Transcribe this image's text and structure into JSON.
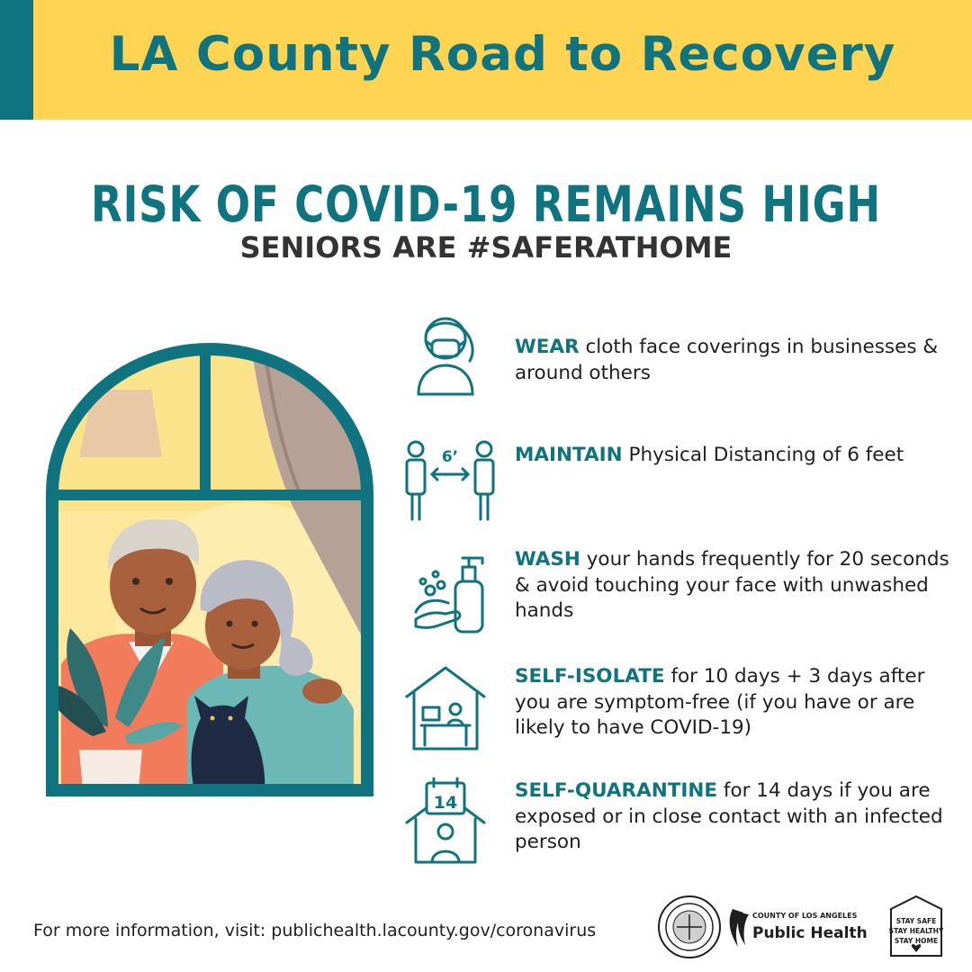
{
  "banner": {
    "title": "LA County Road to Recovery"
  },
  "headline": {
    "title": "RISK OF COVID-19 REMAINS HIGH",
    "subtitle": "SENIORS ARE #SAFERATHOME"
  },
  "tips": [
    {
      "keyword": "WEAR",
      "text": " cloth face coverings in businesses & around others",
      "icon": "face-mask-icon"
    },
    {
      "keyword": "MAINTAIN",
      "text": " Physical Distancing of 6 feet",
      "icon": "physical-distance-icon",
      "icon_label": "6’"
    },
    {
      "keyword": "WASH",
      "text": " your hands frequently for 20 seconds & avoid touching your face with unwashed hands",
      "icon": "hand-wash-icon"
    },
    {
      "keyword": "SELF-ISOLATE",
      "text": " for 10 days + 3 days after you are symptom-free (if you have or are likely to have COVID-19)",
      "icon": "house-isolate-icon"
    },
    {
      "keyword": "SELF-QUARANTINE",
      "text": " for 14 days if you are exposed or in close contact with an infected person",
      "icon": "calendar-quarantine-icon",
      "icon_label": "14"
    }
  ],
  "footer": {
    "text": "For more information, visit: publichealth.lacounty.gov/coronavirus"
  },
  "logos": {
    "public_health_top": "COUNTY OF LOS ANGELES",
    "public_health_bottom": "Public Health",
    "stay_safe_lines": [
      "STAY SAFE",
      "STAY HEALTHY",
      "STAY HOME"
    ]
  },
  "colors": {
    "teal": "#0f7480",
    "yellow": "#ffd452",
    "dark": "#333333"
  }
}
